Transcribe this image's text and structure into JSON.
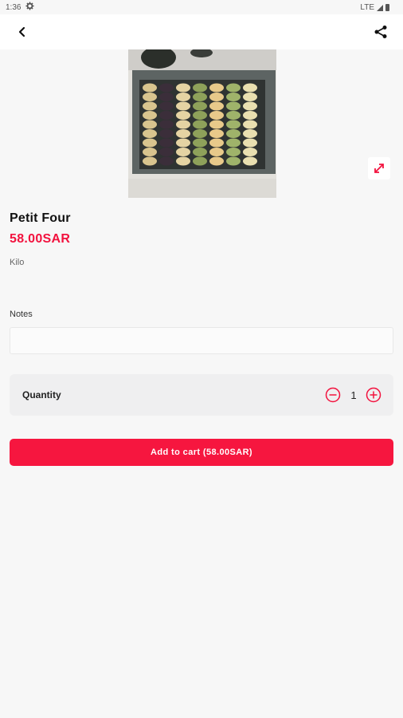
{
  "status_bar": {
    "time": "1:36",
    "network": "LTE"
  },
  "product": {
    "name": "Petit Four",
    "price": "58.00SAR",
    "unit": "Kilo"
  },
  "notes": {
    "label": "Notes",
    "value": "",
    "placeholder": ""
  },
  "quantity": {
    "label": "Quantity",
    "value": "1"
  },
  "cart": {
    "button_label": "Add to cart (58.00SAR)"
  },
  "colors": {
    "accent": "#f6163f",
    "price": "#f2123e",
    "background": "#f7f7f7"
  },
  "icons": [
    "back-arrow-icon",
    "share-icon",
    "expand-icon",
    "minus-circle-icon",
    "plus-circle-icon",
    "settings-gear-icon"
  ]
}
